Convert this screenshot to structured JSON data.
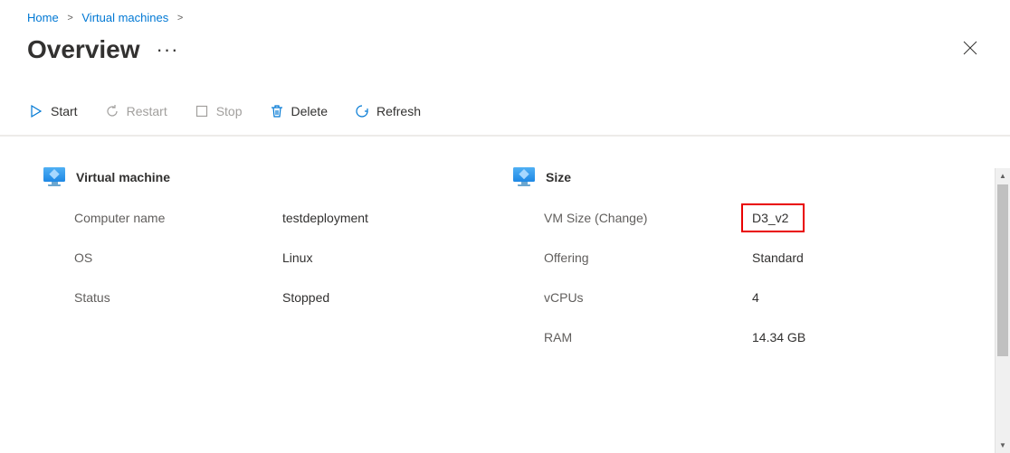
{
  "breadcrumb": {
    "items": [
      {
        "label": "Home"
      },
      {
        "label": "Virtual machines"
      }
    ]
  },
  "header": {
    "title": "Overview",
    "more_label": "···"
  },
  "toolbar": {
    "start_label": "Start",
    "restart_label": "Restart",
    "stop_label": "Stop",
    "delete_label": "Delete",
    "refresh_label": "Refresh"
  },
  "vm_section": {
    "title": "Virtual machine",
    "rows": {
      "computer_name": {
        "label": "Computer name",
        "value": "testdeployment"
      },
      "os": {
        "label": "OS",
        "value": "Linux"
      },
      "status": {
        "label": "Status",
        "value": "Stopped"
      }
    }
  },
  "size_section": {
    "title": "Size",
    "rows": {
      "vm_size": {
        "label_prefix": "VM Size (",
        "change_label": "Change",
        "label_suffix": ")",
        "value": "D3_v2"
      },
      "offering": {
        "label": "Offering",
        "value": "Standard"
      },
      "vcpus": {
        "label": "vCPUs",
        "value": "4"
      },
      "ram": {
        "label": "RAM",
        "value": "14.34 GB"
      }
    }
  }
}
